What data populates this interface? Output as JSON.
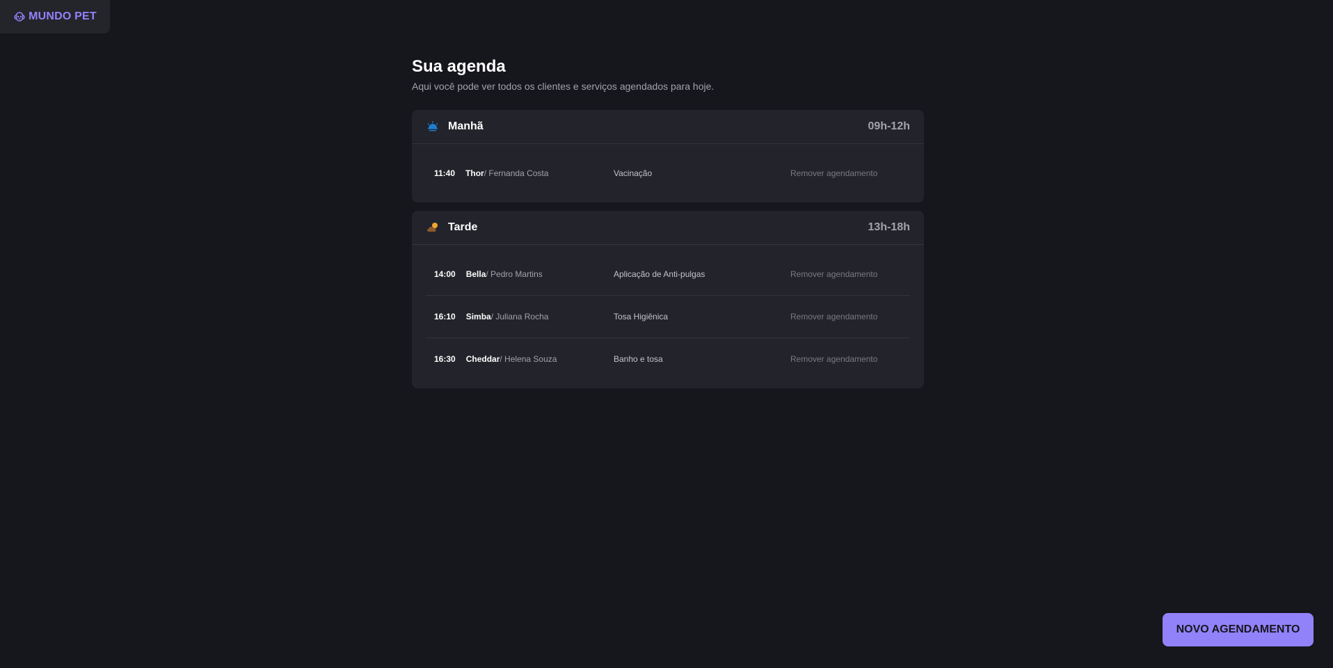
{
  "brand": {
    "logo_icon": "dog-paw-icon",
    "name": "MUNDO PET",
    "accent_color": "#9282fa"
  },
  "page": {
    "title": "Sua agenda",
    "subtitle": "Aqui você pode ver todos os clientes e serviços agendados para hoje."
  },
  "periods": [
    {
      "icon": "sunrise-icon",
      "name": "Manhã",
      "range": "09h-12h",
      "appointments": [
        {
          "time": "11:40",
          "pet": "Thor",
          "owner": " / Fernanda Costa",
          "service": "Vacinação",
          "remove_label": "Remover agendamento"
        }
      ]
    },
    {
      "icon": "cloud-sun-icon",
      "name": "Tarde",
      "range": "13h-18h",
      "appointments": [
        {
          "time": "14:00",
          "pet": "Bella",
          "owner": " / Pedro Martins",
          "service": "Aplicação de Anti-pulgas",
          "remove_label": "Remover agendamento"
        },
        {
          "time": "16:10",
          "pet": "Simba",
          "owner": " / Juliana Rocha",
          "service": "Tosa Higiênica",
          "remove_label": "Remover agendamento"
        },
        {
          "time": "16:30",
          "pet": "Cheddar",
          "owner": " / Helena Souza",
          "service": "Banho e tosa",
          "remove_label": "Remover agendamento"
        }
      ]
    }
  ],
  "actions": {
    "new_appointment_label": "NOVO AGENDAMENTO"
  }
}
